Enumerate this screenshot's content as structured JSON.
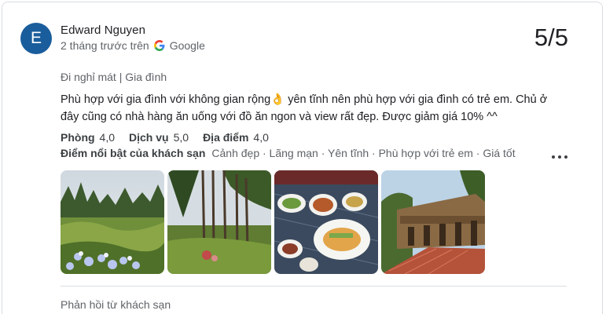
{
  "review": {
    "avatar_initial": "E",
    "author": "Edward Nguyen",
    "time": "2 tháng trước trên",
    "source": "Google",
    "score": "5/5",
    "trip_type": "Đi nghỉ mát | Gia đình",
    "text": "Phù hợp với gia đình với không gian rộng👌 yên tĩnh nên phù hợp với gia đình có trẻ em. Chủ ở đây cũng có nhà hàng ăn uống với đồ ăn ngon và view rất đẹp. Được giảm giá 10% ^^",
    "ratings": [
      {
        "label": "Phòng",
        "value": "4,0"
      },
      {
        "label": "Dịch vụ",
        "value": "5,0"
      },
      {
        "label": "Địa điểm",
        "value": "4,0"
      }
    ],
    "highlights_label": "Điểm nổi bật của khách sạn",
    "highlights": "Cảnh đẹp · Lãng mạn · Yên tĩnh · Phù hợp với trẻ em · Giá tốt",
    "more_icon": "more-horizontal-icon",
    "photos": [
      {
        "name": "garden-hydrangea-photo"
      },
      {
        "name": "pine-forest-photo"
      },
      {
        "name": "food-table-photo"
      },
      {
        "name": "wooden-house-photo"
      }
    ],
    "owner_reply_label": "Phản hồi từ khách sạn"
  },
  "colors": {
    "avatar": "#1a5d9c",
    "secondary_text": "#5f6368",
    "divider": "#dadce0"
  }
}
